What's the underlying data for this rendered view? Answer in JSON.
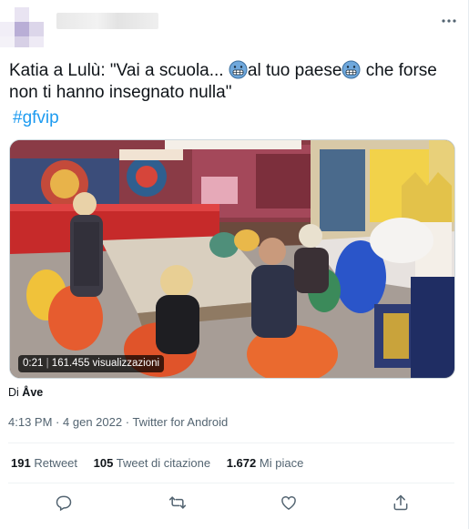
{
  "tweet": {
    "text_part1": "Katia a Lulù: \"Vai a scuola...",
    "text_part2": "al tuo paese",
    "text_part3": "che forse non ti hanno insegnato nulla\"",
    "hashtag": "#gfvip"
  },
  "media": {
    "duration": "0:21",
    "views": "161.455 visualizzazioni"
  },
  "attribution": {
    "prefix": "Di",
    "user": "Åve"
  },
  "meta": {
    "time": "4:13 PM",
    "dot1": "·",
    "date": "4 gen 2022",
    "dot2": "·",
    "source": "Twitter for Android"
  },
  "stats": {
    "retweets_count": "191",
    "retweets_label": "Retweet",
    "quotes_count": "105",
    "quotes_label": "Tweet di citazione",
    "likes_count": "1.672",
    "likes_label": "Mi piace"
  },
  "icons": {
    "more": "more-horizontal-icon",
    "emoji": "grimacing-face-icon",
    "reply": "reply-icon",
    "retweet": "retweet-icon",
    "like": "heart-icon",
    "share": "share-icon"
  },
  "colors": {
    "accent": "#1d9bf0",
    "text": "#0f1419",
    "secondary": "#536471"
  }
}
